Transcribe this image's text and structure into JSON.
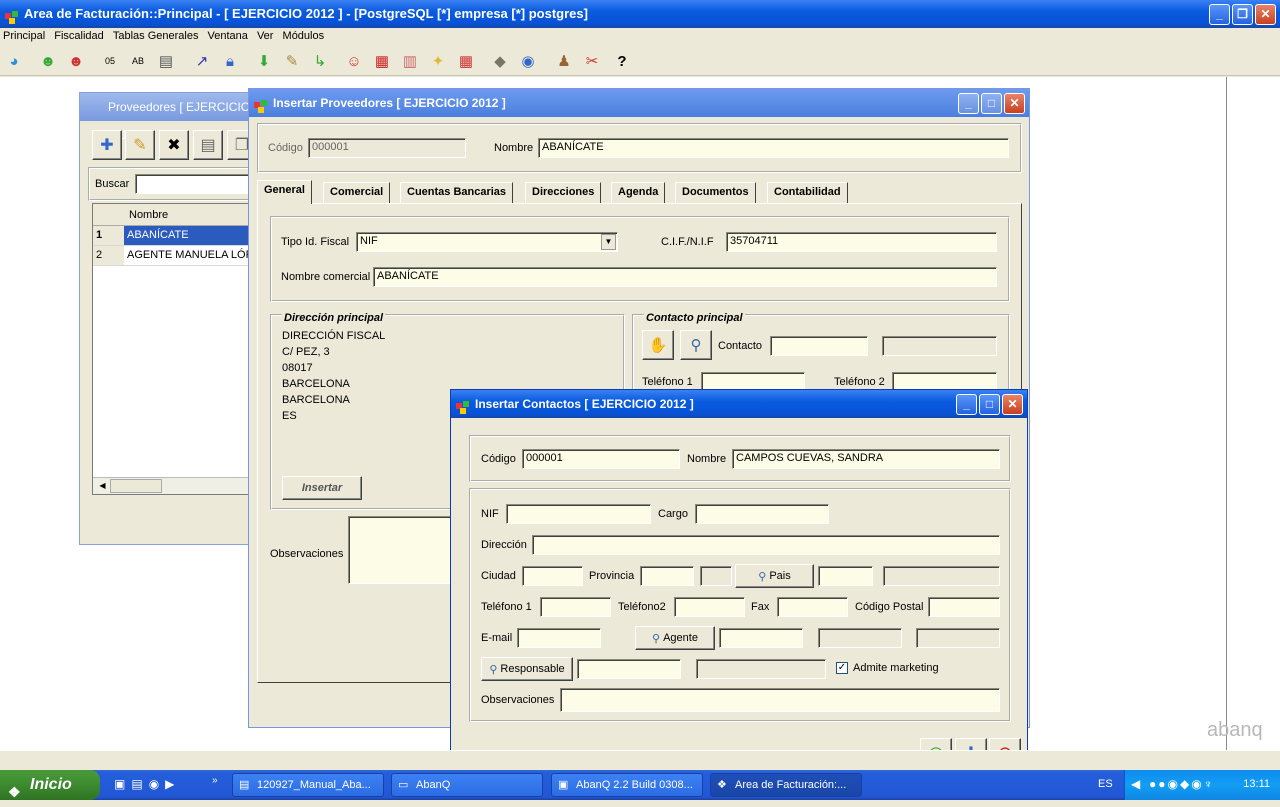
{
  "app": {
    "title": "Area de Facturación::Principal  - [ EJERCICIO 2012 ] - [PostgreSQL [*] empresa [*] postgres]",
    "menu": [
      "Principal",
      "Fiscalidad",
      "Tablas Generales",
      "Ventana",
      "Ver",
      "Módulos"
    ],
    "watermark": "abanq"
  },
  "proveedores": {
    "title": "Proveedores [ EJERCICIO 2012 ]",
    "search_label": "Buscar",
    "search_value": "",
    "column": "Nombre",
    "rows": [
      {
        "n": "1",
        "name": "ABANÍCATE"
      },
      {
        "n": "2",
        "name": "AGENTE MANUELA LÓPEZ"
      }
    ]
  },
  "insertar_proveedores": {
    "title": "Insertar Proveedores [ EJERCICIO 2012 ]",
    "codigo_label": "Código",
    "codigo_value": "000001",
    "nombre_label": "Nombre",
    "nombre_value": "ABANÍCATE",
    "tabs": [
      "General",
      "Comercial",
      "Cuentas Bancarias",
      "Direcciones",
      "Agenda",
      "Documentos",
      "Contabilidad"
    ],
    "tipo_id_label": "Tipo Id. Fiscal",
    "tipo_id_value": "NIF",
    "cif_label": "C.I.F./N.I.F",
    "cif_value": "35704711",
    "nombre_comercial_label": "Nombre comercial",
    "nombre_comercial_value": "ABANÍCATE",
    "direccion_title": "Dirección principal",
    "direccion_lines": [
      "DIRECCIÓN FISCAL",
      "C/ PEZ, 3",
      "08017",
      "BARCELONA",
      "BARCELONA",
      "ES"
    ],
    "insertar_label": "Insertar",
    "contacto_title": "Contacto principal",
    "contacto_label": "Contacto",
    "telefono1_label": "Teléfono 1",
    "telefono2_label": "Teléfono 2",
    "observaciones_label": "Observaciones"
  },
  "insertar_contactos": {
    "title": "Insertar Contactos [ EJERCICIO 2012 ]",
    "codigo_label": "Código",
    "codigo_value": "000001",
    "nombre_label": "Nombre",
    "nombre_value": "CAMPOS CUEVAS, SANDRA",
    "nif_label": "NIF",
    "cargo_label": "Cargo",
    "direccion_label": "Dirección",
    "ciudad_label": "Ciudad",
    "provincia_label": "Provincia",
    "pais_label": "Pais",
    "telefono1_label": "Teléfono 1",
    "telefono2_label": "Teléfono2",
    "fax_label": "Fax",
    "codigo_postal_label": "Código Postal",
    "email_label": "E-mail",
    "agente_label": "Agente",
    "responsable_label": "Responsable",
    "admite_marketing_label": "Admite marketing",
    "admite_marketing_checked": true,
    "observaciones_label": "Observaciones"
  },
  "taskbar": {
    "start": "Inicio",
    "items": [
      "120927_Manual_Aba...",
      "AbanQ",
      "AbanQ 2.2 Build 0308...",
      "Area de Facturación:..."
    ],
    "lang": "ES",
    "clock": "13:11"
  }
}
